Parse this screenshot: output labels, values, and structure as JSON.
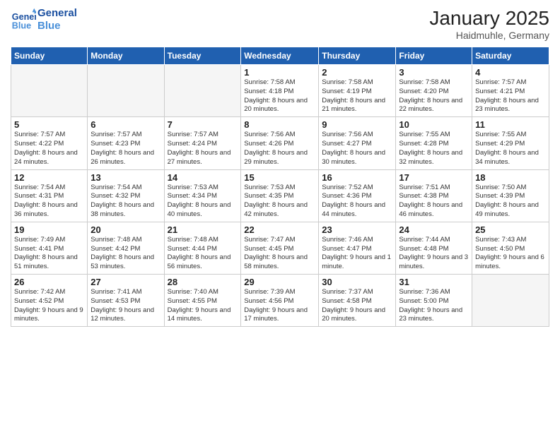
{
  "logo": {
    "line1": "General",
    "line2": "Blue"
  },
  "title": "January 2025",
  "subtitle": "Haidmuhle, Germany",
  "weekdays": [
    "Sunday",
    "Monday",
    "Tuesday",
    "Wednesday",
    "Thursday",
    "Friday",
    "Saturday"
  ],
  "weeks": [
    [
      {
        "day": "",
        "info": ""
      },
      {
        "day": "",
        "info": ""
      },
      {
        "day": "",
        "info": ""
      },
      {
        "day": "1",
        "info": "Sunrise: 7:58 AM\nSunset: 4:18 PM\nDaylight: 8 hours\nand 20 minutes."
      },
      {
        "day": "2",
        "info": "Sunrise: 7:58 AM\nSunset: 4:19 PM\nDaylight: 8 hours\nand 21 minutes."
      },
      {
        "day": "3",
        "info": "Sunrise: 7:58 AM\nSunset: 4:20 PM\nDaylight: 8 hours\nand 22 minutes."
      },
      {
        "day": "4",
        "info": "Sunrise: 7:57 AM\nSunset: 4:21 PM\nDaylight: 8 hours\nand 23 minutes."
      }
    ],
    [
      {
        "day": "5",
        "info": "Sunrise: 7:57 AM\nSunset: 4:22 PM\nDaylight: 8 hours\nand 24 minutes."
      },
      {
        "day": "6",
        "info": "Sunrise: 7:57 AM\nSunset: 4:23 PM\nDaylight: 8 hours\nand 26 minutes."
      },
      {
        "day": "7",
        "info": "Sunrise: 7:57 AM\nSunset: 4:24 PM\nDaylight: 8 hours\nand 27 minutes."
      },
      {
        "day": "8",
        "info": "Sunrise: 7:56 AM\nSunset: 4:26 PM\nDaylight: 8 hours\nand 29 minutes."
      },
      {
        "day": "9",
        "info": "Sunrise: 7:56 AM\nSunset: 4:27 PM\nDaylight: 8 hours\nand 30 minutes."
      },
      {
        "day": "10",
        "info": "Sunrise: 7:55 AM\nSunset: 4:28 PM\nDaylight: 8 hours\nand 32 minutes."
      },
      {
        "day": "11",
        "info": "Sunrise: 7:55 AM\nSunset: 4:29 PM\nDaylight: 8 hours\nand 34 minutes."
      }
    ],
    [
      {
        "day": "12",
        "info": "Sunrise: 7:54 AM\nSunset: 4:31 PM\nDaylight: 8 hours\nand 36 minutes."
      },
      {
        "day": "13",
        "info": "Sunrise: 7:54 AM\nSunset: 4:32 PM\nDaylight: 8 hours\nand 38 minutes."
      },
      {
        "day": "14",
        "info": "Sunrise: 7:53 AM\nSunset: 4:34 PM\nDaylight: 8 hours\nand 40 minutes."
      },
      {
        "day": "15",
        "info": "Sunrise: 7:53 AM\nSunset: 4:35 PM\nDaylight: 8 hours\nand 42 minutes."
      },
      {
        "day": "16",
        "info": "Sunrise: 7:52 AM\nSunset: 4:36 PM\nDaylight: 8 hours\nand 44 minutes."
      },
      {
        "day": "17",
        "info": "Sunrise: 7:51 AM\nSunset: 4:38 PM\nDaylight: 8 hours\nand 46 minutes."
      },
      {
        "day": "18",
        "info": "Sunrise: 7:50 AM\nSunset: 4:39 PM\nDaylight: 8 hours\nand 49 minutes."
      }
    ],
    [
      {
        "day": "19",
        "info": "Sunrise: 7:49 AM\nSunset: 4:41 PM\nDaylight: 8 hours\nand 51 minutes."
      },
      {
        "day": "20",
        "info": "Sunrise: 7:48 AM\nSunset: 4:42 PM\nDaylight: 8 hours\nand 53 minutes."
      },
      {
        "day": "21",
        "info": "Sunrise: 7:48 AM\nSunset: 4:44 PM\nDaylight: 8 hours\nand 56 minutes."
      },
      {
        "day": "22",
        "info": "Sunrise: 7:47 AM\nSunset: 4:45 PM\nDaylight: 8 hours\nand 58 minutes."
      },
      {
        "day": "23",
        "info": "Sunrise: 7:46 AM\nSunset: 4:47 PM\nDaylight: 9 hours\nand 1 minute."
      },
      {
        "day": "24",
        "info": "Sunrise: 7:44 AM\nSunset: 4:48 PM\nDaylight: 9 hours\nand 3 minutes."
      },
      {
        "day": "25",
        "info": "Sunrise: 7:43 AM\nSunset: 4:50 PM\nDaylight: 9 hours\nand 6 minutes."
      }
    ],
    [
      {
        "day": "26",
        "info": "Sunrise: 7:42 AM\nSunset: 4:52 PM\nDaylight: 9 hours\nand 9 minutes."
      },
      {
        "day": "27",
        "info": "Sunrise: 7:41 AM\nSunset: 4:53 PM\nDaylight: 9 hours\nand 12 minutes."
      },
      {
        "day": "28",
        "info": "Sunrise: 7:40 AM\nSunset: 4:55 PM\nDaylight: 9 hours\nand 14 minutes."
      },
      {
        "day": "29",
        "info": "Sunrise: 7:39 AM\nSunset: 4:56 PM\nDaylight: 9 hours\nand 17 minutes."
      },
      {
        "day": "30",
        "info": "Sunrise: 7:37 AM\nSunset: 4:58 PM\nDaylight: 9 hours\nand 20 minutes."
      },
      {
        "day": "31",
        "info": "Sunrise: 7:36 AM\nSunset: 5:00 PM\nDaylight: 9 hours\nand 23 minutes."
      },
      {
        "day": "",
        "info": ""
      }
    ]
  ]
}
